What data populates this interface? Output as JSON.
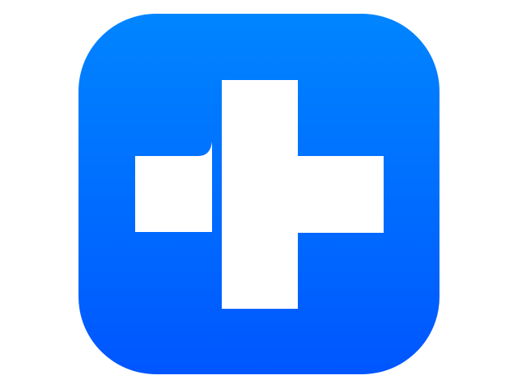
{
  "app_icon": {
    "name": "medical-cross-app-icon",
    "gradient_top": "#0085FF",
    "gradient_bottom": "#0056FF",
    "glyph_color": "#FFFFFF",
    "glyph": "plus-cross-icon"
  }
}
